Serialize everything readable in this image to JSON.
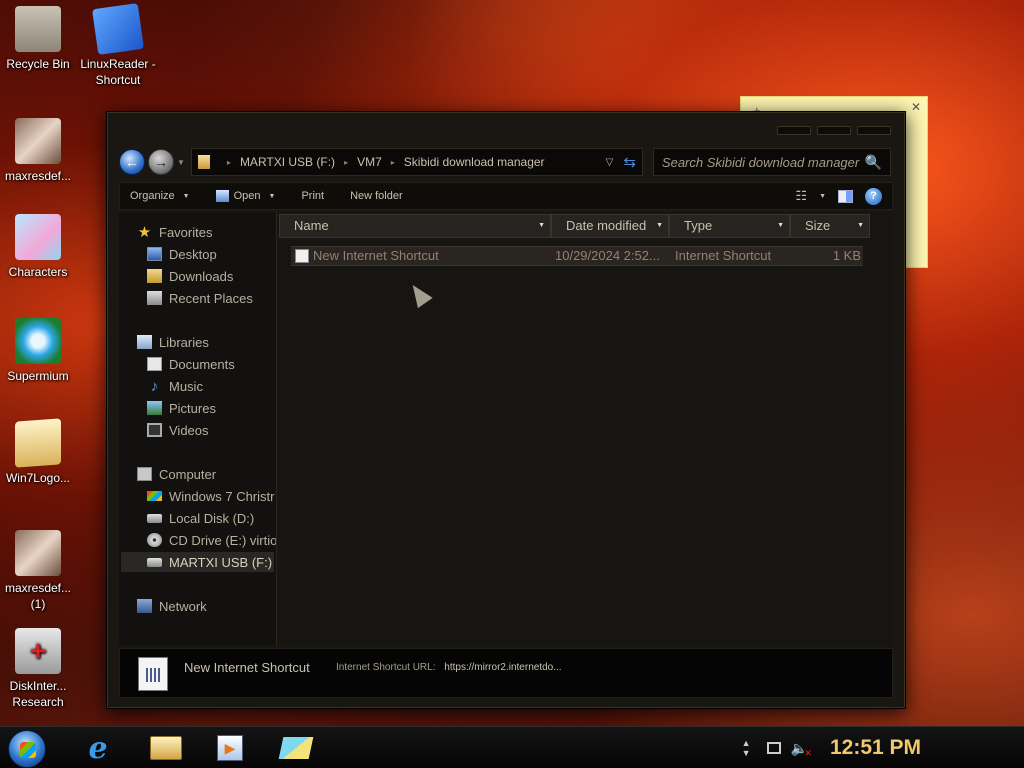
{
  "desktop": {
    "icons": [
      {
        "label": "Recycle Bin",
        "icon": "recycle-bin-icon"
      },
      {
        "label": "LinuxReader - Shortcut",
        "icon": "linuxreader-icon"
      },
      {
        "label": "maxresdef...",
        "icon": "image-file-icon"
      },
      {
        "label": "Characters",
        "icon": "image-file-icon"
      },
      {
        "label": "Supermium",
        "icon": "supermium-browser-icon"
      },
      {
        "label": "Win7Logo...",
        "icon": "folder-icon"
      },
      {
        "label": "maxresdef... (1)",
        "icon": "image-file-icon"
      },
      {
        "label": "DiskInter... Research",
        "icon": "disk-internals-icon"
      }
    ]
  },
  "window": {
    "breadcrumb": [
      "MARTXI USB (F:)",
      "VM7",
      "Skibidi download manager"
    ],
    "search_placeholder": "Search Skibidi download manager",
    "toolbar": {
      "organize": "Organize",
      "open": "Open",
      "print": "Print",
      "new_folder": "New folder"
    },
    "navpane": {
      "favorites": "Favorites",
      "desktop": "Desktop",
      "downloads": "Downloads",
      "recent_places": "Recent Places",
      "libraries": "Libraries",
      "documents": "Documents",
      "music": "Music",
      "pictures": "Pictures",
      "videos": "Videos",
      "computer": "Computer",
      "drive_c": "Windows 7 Christr",
      "drive_d": "Local Disk (D:)",
      "drive_e": "CD Drive (E:) virtio",
      "drive_f": "MARTXI USB (F:)",
      "network": "Network"
    },
    "columns": [
      "Name",
      "Date modified",
      "Type",
      "Size"
    ],
    "files": [
      {
        "name": "New Internet Shortcut",
        "date": "10/29/2024 2:52...",
        "type": "Internet Shortcut",
        "size": "1 KB"
      }
    ],
    "details": {
      "name": "New Internet Shortcut",
      "meta_label": "Internet Shortcut URL:",
      "meta_value": "https://mirror2.internetdo..."
    }
  },
  "taskbar": {
    "clock": "12:51 PM"
  },
  "colors": {
    "clock": "#f0c870",
    "window_bg": "#1a1712",
    "text": "#c9c1ae"
  }
}
